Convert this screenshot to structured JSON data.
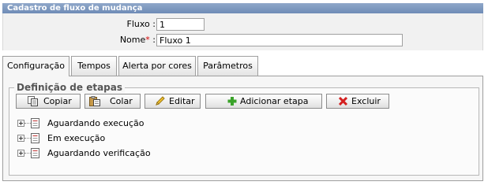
{
  "panel": {
    "title": "Cadastro de fluxo de mudança"
  },
  "form": {
    "fluxo_label": "Fluxo :",
    "fluxo_value": "1",
    "nome_label": "Nome",
    "nome_required": "*",
    "nome_colon": ":",
    "nome_value": "Fluxo 1"
  },
  "tabs": [
    {
      "label": "Configuração",
      "active": true
    },
    {
      "label": "Tempos"
    },
    {
      "label": "Alerta por cores"
    },
    {
      "label": "Parâmetros"
    }
  ],
  "etapas": {
    "legend": "Definição de etapas",
    "buttons": {
      "copiar": "Copiar",
      "colar": "Colar",
      "editar": "Editar",
      "adicionar": "Adicionar etapa",
      "excluir": "Excluir"
    },
    "tree": [
      {
        "label": "Aguardando execução"
      },
      {
        "label": "Em execução"
      },
      {
        "label": "Aguardando verificação"
      }
    ]
  },
  "colors": {
    "header": "#7a96c0",
    "add_icon": "#3aa32a",
    "delete_icon": "#d42020",
    "required": "#d40000"
  }
}
